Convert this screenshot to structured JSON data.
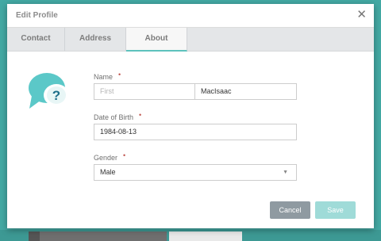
{
  "dialog": {
    "title": "Edit Profile",
    "close_glyph": "✕"
  },
  "tabs": [
    {
      "label": "Contact"
    },
    {
      "label": "Address"
    },
    {
      "label": "About"
    }
  ],
  "illustration": {
    "icon": "chat-question-icon",
    "glyph": "?"
  },
  "form": {
    "name_label": "Name",
    "required_mark": "•",
    "first_placeholder": "First",
    "last_value": "MacIsaac",
    "dob_label": "Date of Birth",
    "dob_value": "1984-08-13",
    "gender_label": "Gender",
    "gender_value": "Male",
    "select_caret": "▼"
  },
  "buttons": {
    "cancel": "Cancel",
    "save": "Save"
  },
  "colors": {
    "accent": "#5ec2bd",
    "cancel_button": "#8f9aa1",
    "save_button": "#9fdbd8",
    "required": "#c0564f"
  }
}
